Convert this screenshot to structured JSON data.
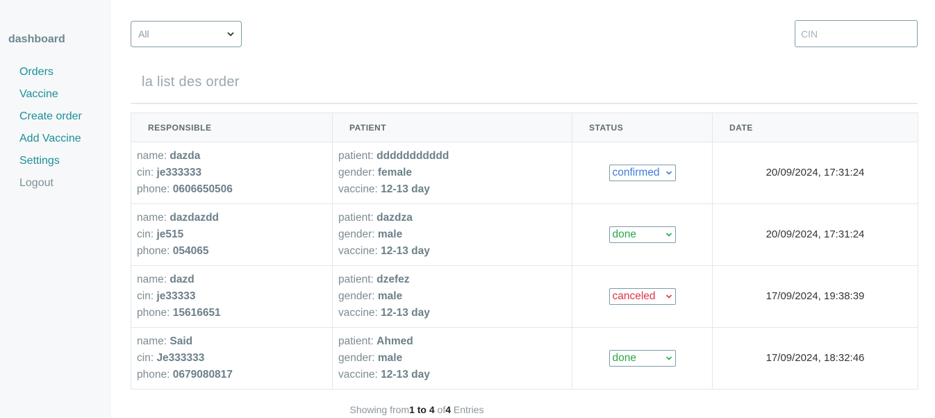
{
  "sidebar": {
    "brand": "dashboard",
    "items": [
      {
        "label": "Orders"
      },
      {
        "label": "Vaccine"
      },
      {
        "label": "Create order"
      },
      {
        "label": "Add Vaccine"
      },
      {
        "label": "Settings"
      },
      {
        "label": "Logout"
      }
    ]
  },
  "filter": {
    "selected": "All"
  },
  "search": {
    "placeholder": "CIN"
  },
  "page": {
    "title": "la list des order"
  },
  "table": {
    "headers": [
      "RESPONSIBLE",
      "PATIENT",
      "STATUS",
      "DATE"
    ],
    "field_labels": {
      "name": "name: ",
      "cin": "cin: ",
      "phone": "phone: ",
      "patient": "patient: ",
      "gender": "gender: ",
      "vaccine": "vaccine: "
    },
    "rows": [
      {
        "name": "dazda",
        "cin": "je333333",
        "phone": "0606650506",
        "patient": "ddddddddddd",
        "gender": "female",
        "vaccine": "12-13 day",
        "status": "confirmed",
        "date": "20/09/2024, 17:31:24"
      },
      {
        "name": "dazdazdd",
        "cin": "je515",
        "phone": "054065",
        "patient": "dazdza",
        "gender": "male",
        "vaccine": "12-13 day",
        "status": "done",
        "date": "20/09/2024, 17:31:24"
      },
      {
        "name": "dazd",
        "cin": "je33333",
        "phone": "15616651",
        "patient": "dzefez",
        "gender": "male",
        "vaccine": "12-13 day",
        "status": "canceled",
        "date": "17/09/2024, 19:38:39"
      },
      {
        "name": "Said",
        "cin": "Je333333",
        "phone": "0679080817",
        "patient": "Ahmed",
        "gender": "male",
        "vaccine": "12-13 day",
        "status": "done",
        "date": "17/09/2024, 18:32:46"
      }
    ]
  },
  "status_colors": {
    "confirmed": "#3b7dd8",
    "done": "#28a745",
    "canceled": "#dc3545"
  },
  "footer": {
    "prefix": "Showing from",
    "from_to": "1 to 4",
    "of": " of",
    "total": "4",
    "suffix": " Entries"
  },
  "icons": {
    "select_caret": "chevron-down-icon"
  }
}
